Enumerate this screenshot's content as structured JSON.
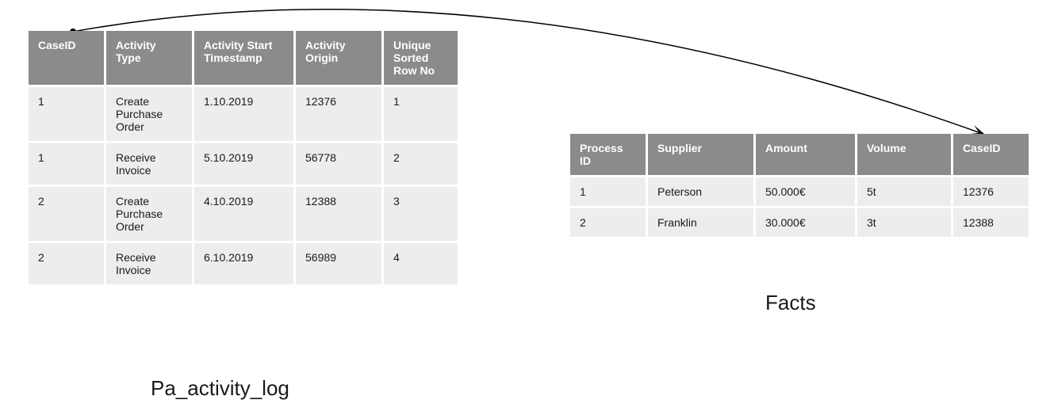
{
  "left_table": {
    "caption": "Pa_activity_log",
    "columns": [
      "CaseID",
      "Activity Type",
      "Activity Start Timestamp",
      "Activity Origin",
      "Unique Sorted Row No"
    ],
    "rows": [
      [
        "1",
        "Create Purchase Order",
        "1.10.2019",
        "12376",
        "1"
      ],
      [
        "1",
        "Receive Invoice",
        "5.10.2019",
        "56778",
        "2"
      ],
      [
        "2",
        "Create Purchase Order",
        "4.10.2019",
        "12388",
        "3"
      ],
      [
        "2",
        "Receive Invoice",
        "6.10.2019",
        "56989",
        "4"
      ]
    ]
  },
  "right_table": {
    "caption": "Facts",
    "columns": [
      "Process ID",
      "Supplier",
      "Amount",
      "Volume",
      "CaseID"
    ],
    "rows": [
      [
        "1",
        "Peterson",
        "50.000€",
        "5t",
        "12376"
      ],
      [
        "2",
        "Franklin",
        "30.000€",
        "3t",
        "12388"
      ]
    ]
  }
}
